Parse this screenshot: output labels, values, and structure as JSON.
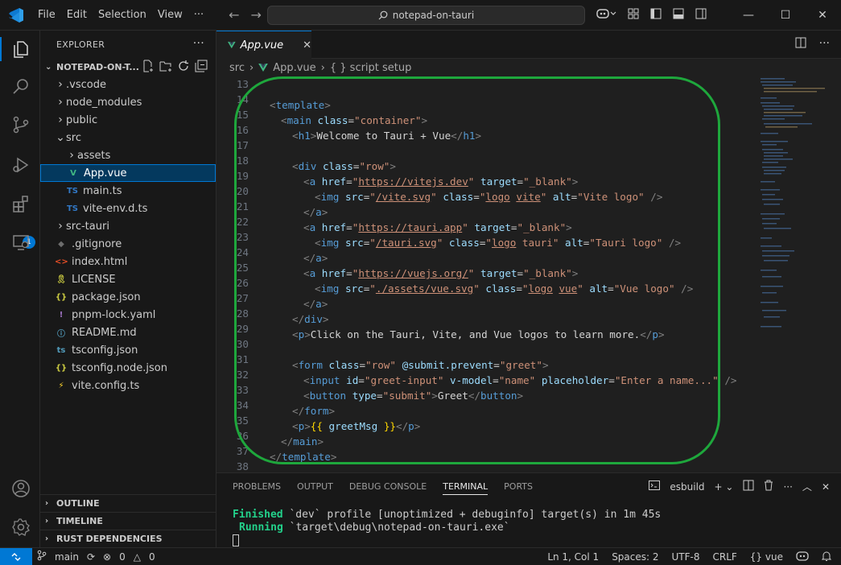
{
  "titlebar": {
    "menu": [
      "File",
      "Edit",
      "Selection",
      "View",
      "···"
    ],
    "search": "notepad-on-tauri"
  },
  "sidebar": {
    "title": "EXPLORER",
    "project": "NOTEPAD-ON-T...",
    "tree": [
      {
        "label": ".vscode",
        "type": "folder",
        "depth": 1,
        "open": false
      },
      {
        "label": "node_modules",
        "type": "folder",
        "depth": 1,
        "open": false
      },
      {
        "label": "public",
        "type": "folder",
        "depth": 1,
        "open": false
      },
      {
        "label": "src",
        "type": "folder",
        "depth": 1,
        "open": true
      },
      {
        "label": "assets",
        "type": "folder",
        "depth": 2,
        "open": false
      },
      {
        "label": "App.vue",
        "type": "vue",
        "depth": 2,
        "selected": true
      },
      {
        "label": "main.ts",
        "type": "ts",
        "depth": 2
      },
      {
        "label": "vite-env.d.ts",
        "type": "ts",
        "depth": 2
      },
      {
        "label": "src-tauri",
        "type": "folder",
        "depth": 1,
        "open": false
      },
      {
        "label": ".gitignore",
        "type": "git",
        "depth": 1
      },
      {
        "label": "index.html",
        "type": "html",
        "depth": 1
      },
      {
        "label": "LICENSE",
        "type": "license",
        "depth": 1
      },
      {
        "label": "package.json",
        "type": "json",
        "depth": 1
      },
      {
        "label": "pnpm-lock.yaml",
        "type": "yaml",
        "depth": 1
      },
      {
        "label": "README.md",
        "type": "info",
        "depth": 1
      },
      {
        "label": "tsconfig.json",
        "type": "tsjson",
        "depth": 1
      },
      {
        "label": "tsconfig.node.json",
        "type": "json",
        "depth": 1
      },
      {
        "label": "vite.config.ts",
        "type": "vite",
        "depth": 1
      }
    ],
    "sections": [
      "OUTLINE",
      "TIMELINE",
      "RUST DEPENDENCIES"
    ]
  },
  "activity_badge": "1",
  "editor": {
    "tab": "App.vue",
    "breadcrumb": [
      "src",
      "App.vue",
      "{ } script setup"
    ],
    "lines": [
      13,
      14,
      15,
      16,
      17,
      18,
      19,
      20,
      21,
      22,
      23,
      24,
      25,
      26,
      27,
      28,
      29,
      30,
      31,
      32,
      33,
      34,
      35,
      36,
      37,
      38
    ]
  },
  "panel": {
    "tabs": [
      "PROBLEMS",
      "OUTPUT",
      "DEBUG CONSOLE",
      "TERMINAL",
      "PORTS"
    ],
    "active_tab": "TERMINAL",
    "terminal_name": "esbuild",
    "term1_keyword": "Finished",
    "term1_rest": " `dev` profile [unoptimized + debuginfo] target(s) in 1m 45s",
    "term2_keyword": "Running",
    "term2_rest": " `target\\debug\\notepad-on-tauri.exe`"
  },
  "statusbar": {
    "branch": "main",
    "problems": "0",
    "warnings": "0",
    "position": "Ln 1, Col 1",
    "spaces": "Spaces: 2",
    "encoding": "UTF-8",
    "eol": "CRLF",
    "language": "vue"
  },
  "colors": {
    "accent": "#0078d4",
    "ring": "#1ea73c",
    "vue": "#41b883"
  }
}
